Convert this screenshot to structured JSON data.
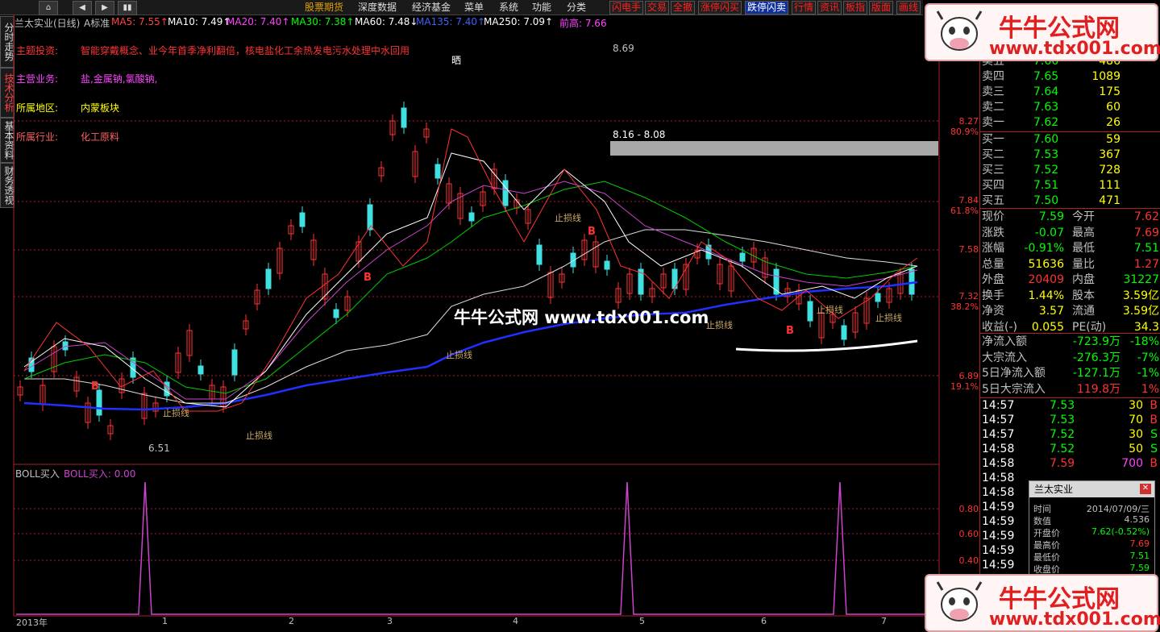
{
  "toolbar": {
    "nav": [
      "⌂",
      "◀",
      "▶",
      "▮▮"
    ],
    "menus": [
      "股票期货",
      "深度数据",
      "经济基金",
      "菜单",
      "系统",
      "功能",
      "分类"
    ],
    "buttons": [
      "闪电手",
      "交易",
      "全撤",
      "涨停闪买",
      "跌停闪卖",
      "行情",
      "资讯",
      "板指",
      "版面",
      "画线"
    ]
  },
  "left_tabs": [
    "分时走势",
    "技术分析",
    "基本资料",
    "财务透视"
  ],
  "chart_header": {
    "title": "兰太实业(日线)",
    "mode": "A标准",
    "ma": [
      {
        "label": "MA5: 7.55",
        "arrow": "↑",
        "color": "#ff4444"
      },
      {
        "label": "MA10: 7.49",
        "arrow": "↑",
        "color": "#ffffff"
      },
      {
        "label": "MA20: 7.40",
        "arrow": "↑",
        "color": "#ff44ff"
      },
      {
        "label": "MA30: 7.38",
        "arrow": "↑",
        "color": "#00ff00"
      },
      {
        "label": "MA60: 7.48",
        "arrow": "↓",
        "color": "#ffffff"
      },
      {
        "label": "MA135: 7.40",
        "arrow": "↑",
        "color": "#4060ff"
      },
      {
        "label": "MA250: 7.09",
        "arrow": "↑",
        "color": "#ffffff"
      },
      {
        "label": "前高: 7.66",
        "arrow": "",
        "color": "#ff44ff"
      }
    ]
  },
  "info": [
    {
      "key": "主题投资:",
      "value": "智能穿戴概念、业今年首季净利翻倍，核电盐化工余热发电污水处理中水回用",
      "color": "#ff3333"
    },
    {
      "key": "主营业务:",
      "value": "盐,金属钠,氯酸钠,",
      "color": "#ff44ff"
    },
    {
      "key": "所属地区:",
      "value": "内蒙板块",
      "color": "#ffff00"
    },
    {
      "key": "所属行业:",
      "value": "化工原料",
      "color": "#ff6060"
    }
  ],
  "chart_annotations": {
    "high": "8.69",
    "low": "6.51",
    "zone": "8.16 - 8.08",
    "stoploss": "止损线",
    "buy": "B",
    "star": "晒",
    "watermark_center": "牛牛公式网 www.tdx001.com"
  },
  "price_axis": {
    "labels": [
      "8.27",
      "80.9%",
      "7.84",
      "61.8%",
      "7.58",
      "7.32",
      "38.2%",
      "6.89",
      "19.1%"
    ]
  },
  "indicator": {
    "name": "BOLL买入",
    "value_label": "BOLL买入: 0.00",
    "axis": [
      "0.80",
      "0.60",
      "0.40"
    ]
  },
  "date_axis": [
    "2013年",
    "1",
    "2",
    "3",
    "4",
    "5",
    "6",
    "7"
  ],
  "quotes": {
    "asks": [
      {
        "label": "卖五",
        "price": "7.66",
        "vol": "486"
      },
      {
        "label": "卖四",
        "price": "7.65",
        "vol": "1089"
      },
      {
        "label": "卖三",
        "price": "7.64",
        "vol": "175"
      },
      {
        "label": "卖二",
        "price": "7.63",
        "vol": "60"
      },
      {
        "label": "卖一",
        "price": "7.62",
        "vol": "26"
      }
    ],
    "bids": [
      {
        "label": "买一",
        "price": "7.60",
        "vol": "59"
      },
      {
        "label": "买二",
        "price": "7.53",
        "vol": "367"
      },
      {
        "label": "买三",
        "price": "7.52",
        "vol": "728"
      },
      {
        "label": "买四",
        "price": "7.51",
        "vol": "111"
      },
      {
        "label": "买五",
        "price": "7.50",
        "vol": "471"
      }
    ],
    "stats": [
      {
        "k1": "现价",
        "v1": "7.59",
        "c1": "grn",
        "k2": "今开",
        "v2": "7.62",
        "c2": "red"
      },
      {
        "k1": "涨跌",
        "v1": "-0.07",
        "c1": "grn",
        "k2": "最高",
        "v2": "7.69",
        "c2": "red"
      },
      {
        "k1": "涨幅",
        "v1": "-0.91%",
        "c1": "grn",
        "k2": "最低",
        "v2": "7.51",
        "c2": "grn"
      },
      {
        "k1": "总量",
        "v1": "51636",
        "c1": "yel",
        "k2": "量比",
        "v2": "1.27",
        "c2": "red"
      },
      {
        "k1": "外盘",
        "v1": "20409",
        "c1": "red",
        "k2": "内盘",
        "v2": "31227",
        "c2": "grn"
      },
      {
        "k1": "换手",
        "v1": "1.44%",
        "c1": "yel",
        "k2": "股本",
        "v2": "3.59亿",
        "c2": "yel"
      },
      {
        "k1": "净资",
        "v1": "3.57",
        "c1": "yel",
        "k2": "流通",
        "v2": "3.59亿",
        "c2": "yel"
      },
      {
        "k1": "收益(-)",
        "v1": "0.055",
        "c1": "yel",
        "k2": "PE(动)",
        "v2": "34.3",
        "c2": "yel"
      }
    ],
    "flows": [
      {
        "k": "净流入额",
        "v": "-723.9万",
        "p": "-18%"
      },
      {
        "k": "大宗流入",
        "v": "-276.3万",
        "p": "-7%"
      },
      {
        "k": "5日净流入额",
        "v": "-127.1万",
        "p": "-1%"
      },
      {
        "k": "5日大宗流入",
        "v": "119.8万",
        "p": "1%"
      }
    ],
    "ticks": [
      {
        "t": "14:57",
        "p": "7.53",
        "v": "30",
        "s": "B"
      },
      {
        "t": "14:57",
        "p": "7.53",
        "v": "70",
        "s": "B"
      },
      {
        "t": "14:57",
        "p": "7.52",
        "v": "30",
        "s": "S"
      },
      {
        "t": "14:58",
        "p": "7.52",
        "v": "50",
        "s": "S"
      },
      {
        "t": "14:58",
        "p": "7.59",
        "v": "700",
        "s": "B"
      },
      {
        "t": "14:58",
        "p": "",
        "v": "",
        "s": ""
      },
      {
        "t": "14:58",
        "p": "",
        "v": "",
        "s": ""
      },
      {
        "t": "14:59",
        "p": "",
        "v": "",
        "s": ""
      },
      {
        "t": "14:59",
        "p": "",
        "v": "",
        "s": ""
      },
      {
        "t": "14:59",
        "p": "",
        "v": "",
        "s": ""
      },
      {
        "t": "14:59",
        "p": "",
        "v": "",
        "s": ""
      },
      {
        "t": "14:59",
        "p": "",
        "v": "",
        "s": ""
      }
    ]
  },
  "popup": {
    "title": "兰太实业",
    "rows": [
      {
        "k": "时间",
        "v": "2014/07/09/三",
        "c": "#c0c0c0"
      },
      {
        "k": "数值",
        "v": "4.536",
        "c": "#c0c0c0"
      },
      {
        "k": "开盘价",
        "v": "7.62(-0.52%)",
        "c": "#00ff00"
      },
      {
        "k": "最高价",
        "v": "7.69",
        "c": "#ff3333"
      },
      {
        "k": "最低价",
        "v": "7.51",
        "c": "#00ff00"
      },
      {
        "k": "收盘价",
        "v": "7.59",
        "c": "#00ff00"
      }
    ]
  },
  "watermark": {
    "title": "牛牛公式网",
    "url": "www.tdx001.com"
  }
}
